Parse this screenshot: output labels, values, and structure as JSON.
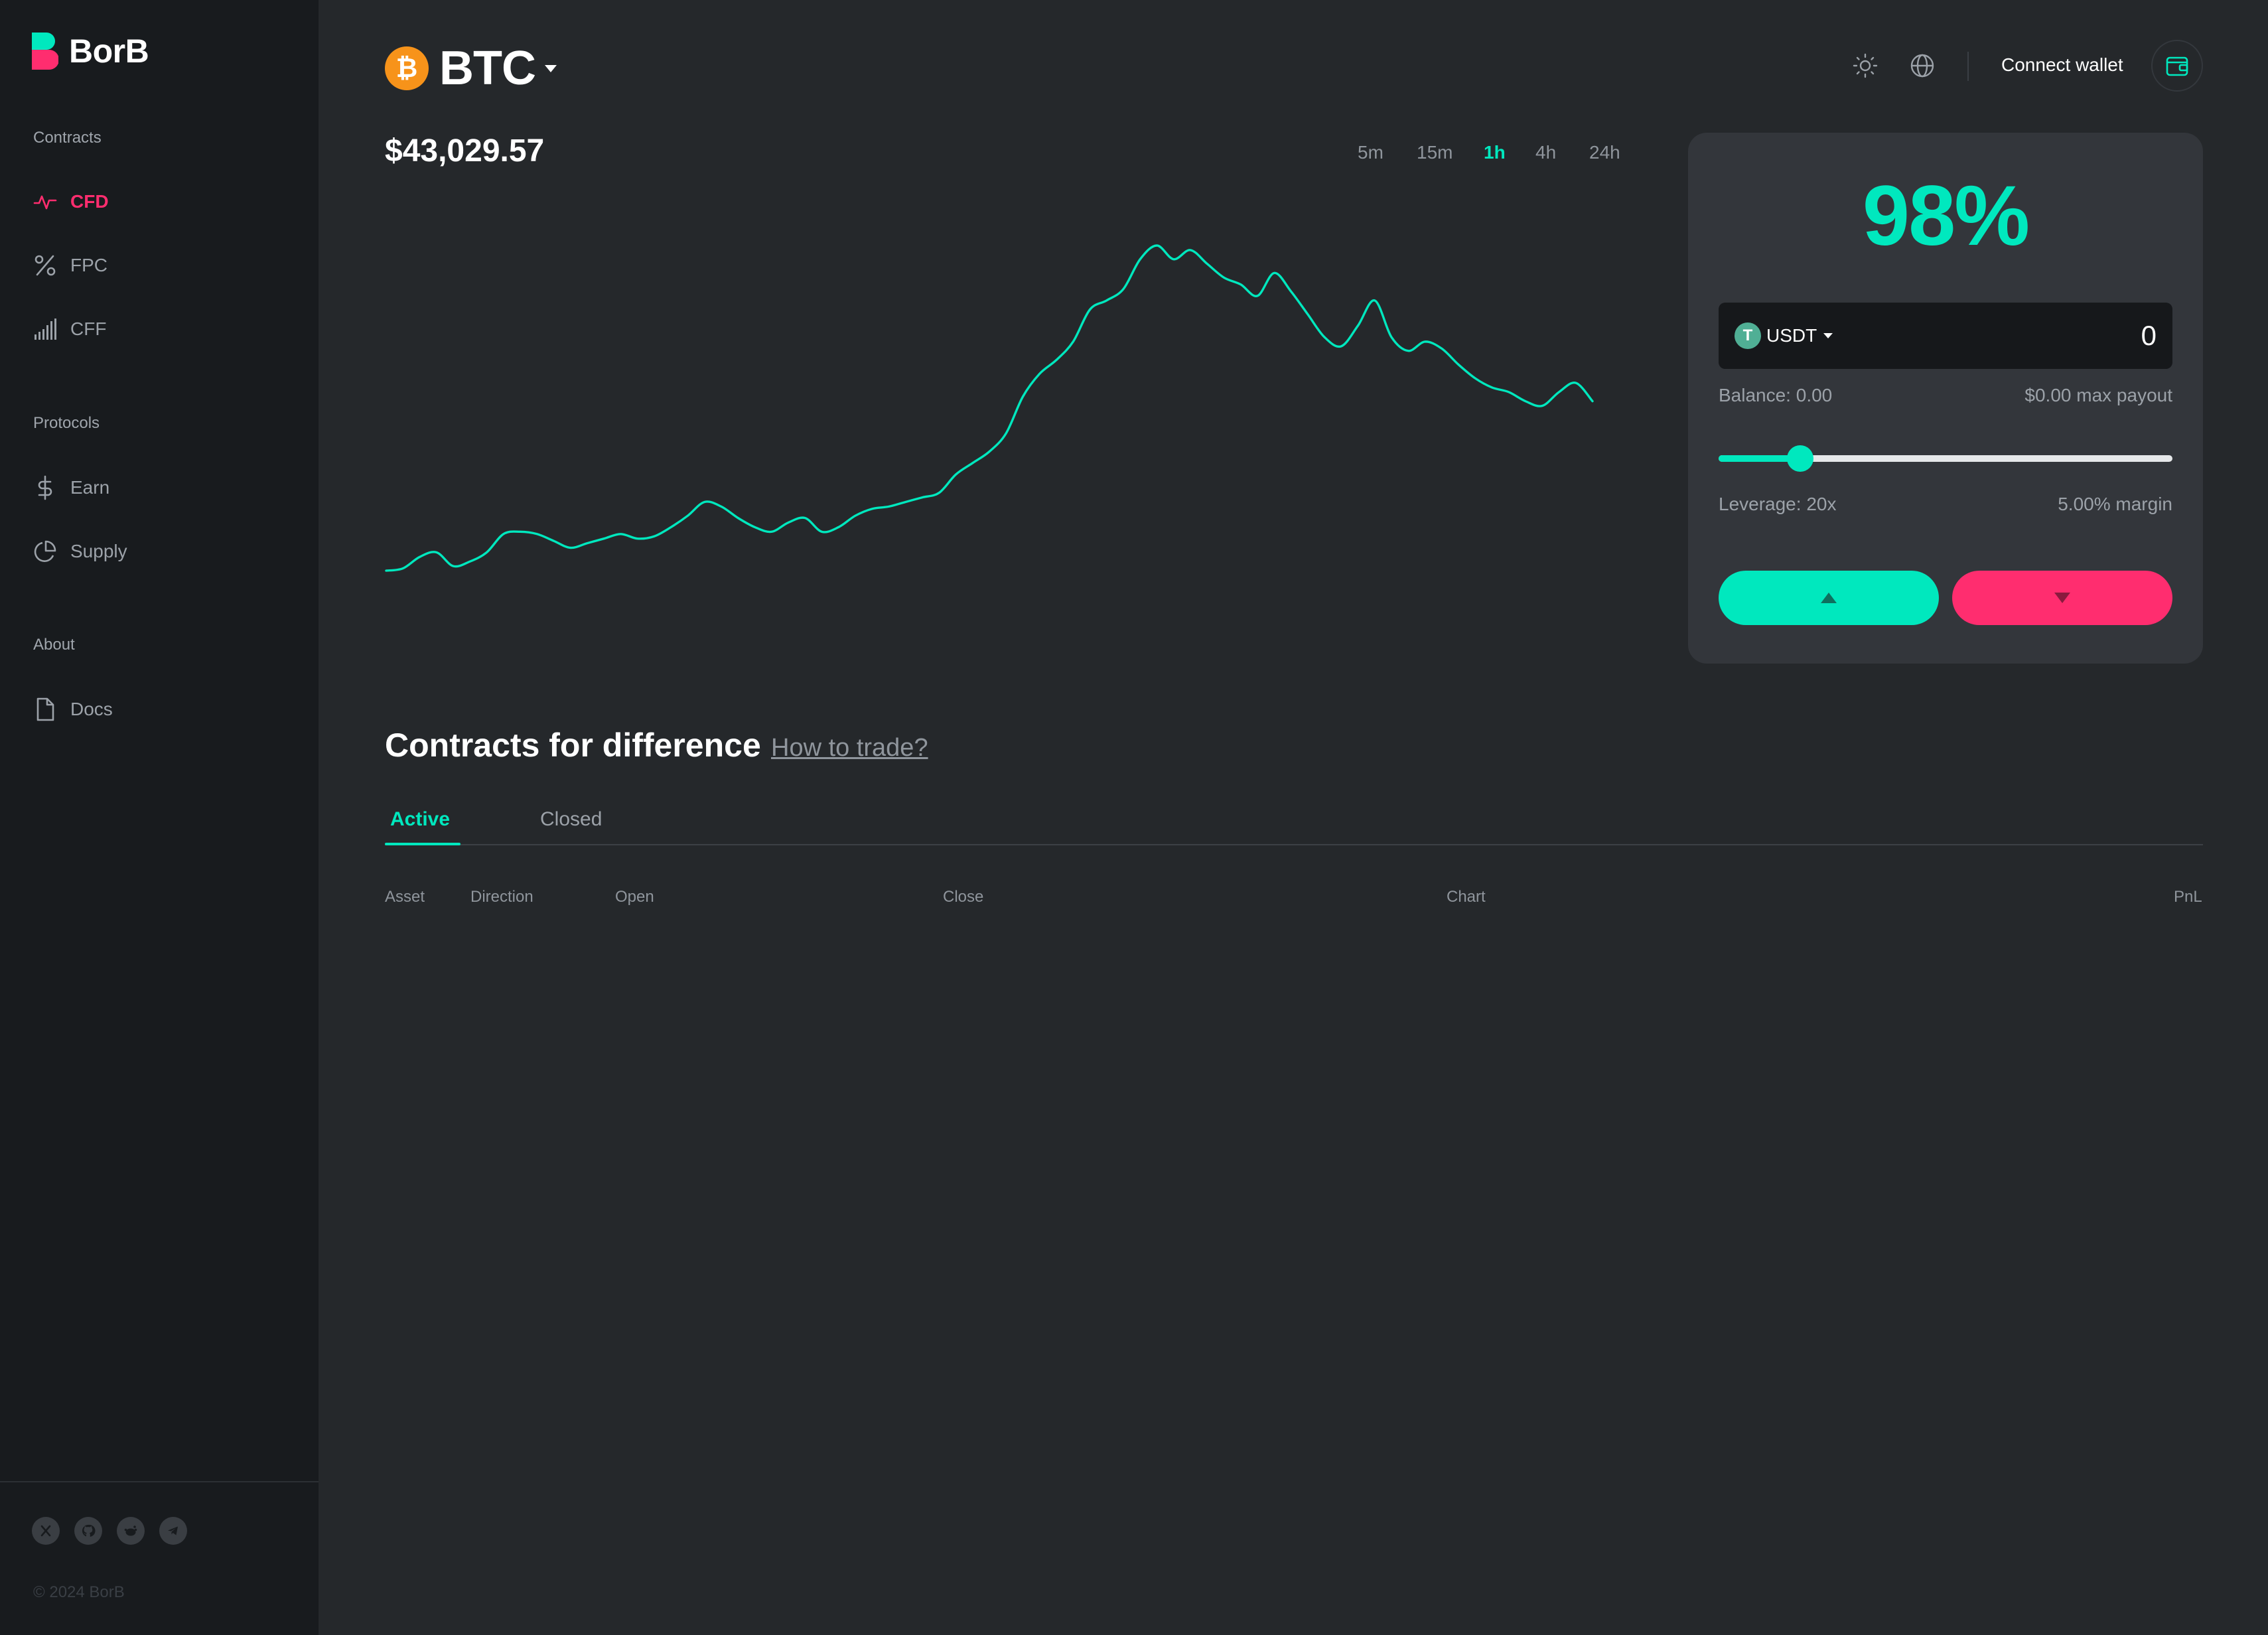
{
  "app": {
    "name": "BorB"
  },
  "sidebar": {
    "sections": {
      "contracts": "Contracts",
      "protocols": "Protocols",
      "about": "About"
    },
    "items": [
      {
        "label": "CFD",
        "icon": "activity-icon",
        "active": true
      },
      {
        "label": "FPC",
        "icon": "percent-icon",
        "active": false
      },
      {
        "label": "CFF",
        "icon": "signal-bars-icon",
        "active": false
      },
      {
        "label": "Earn",
        "icon": "dollar-icon",
        "active": false
      },
      {
        "label": "Supply",
        "icon": "pie-chart-icon",
        "active": false
      },
      {
        "label": "Docs",
        "icon": "document-icon",
        "active": false
      }
    ],
    "socials": [
      "x-icon",
      "github-icon",
      "reddit-icon",
      "telegram-icon"
    ],
    "copyright": "© 2024 BorB"
  },
  "header": {
    "asset": "BTC",
    "asset_icon": "bitcoin-icon",
    "asset_symbol": "₿",
    "connect_wallet": "Connect wallet"
  },
  "market": {
    "price": "$43,029.57",
    "timeframes": [
      "5m",
      "15m",
      "1h",
      "4h",
      "24h"
    ],
    "active_timeframe": "1h"
  },
  "chart_data": {
    "type": "line",
    "color": "#00e8be",
    "series": [
      {
        "values": [
          40,
          41,
          46,
          48,
          42,
          44,
          48,
          56,
          57,
          56,
          53,
          50,
          52,
          54,
          56,
          54,
          55,
          59,
          64,
          70,
          68,
          63,
          59,
          57,
          61,
          63,
          57,
          59,
          64,
          67,
          68,
          70,
          72,
          74,
          82,
          87,
          92,
          100,
          116,
          126,
          132,
          140,
          154,
          158,
          163,
          176,
          182,
          176,
          180,
          174,
          168,
          165,
          160,
          170,
          162,
          152,
          142,
          138,
          147,
          158,
          142,
          136,
          140,
          137,
          130,
          124,
          120,
          118,
          114,
          112,
          118,
          122,
          114
        ]
      }
    ]
  },
  "trade_panel": {
    "payout": "98%",
    "token": "USDT",
    "token_symbol": "T",
    "amount": "0",
    "balance": "Balance: 0.00",
    "max_payout": "$0.00 max payout",
    "leverage": "Leverage: 20x",
    "margin": "5.00% margin",
    "leverage_fraction": 0.18,
    "up_color": "#00e8be",
    "down_color": "#ff2d6f"
  },
  "section": {
    "title": "Contracts for difference",
    "how_link": "How to trade?",
    "tabs": [
      "Active",
      "Closed"
    ],
    "active_tab": "Active",
    "columns": [
      "Asset",
      "Direction",
      "Open",
      "Close",
      "Chart",
      "PnL"
    ]
  }
}
